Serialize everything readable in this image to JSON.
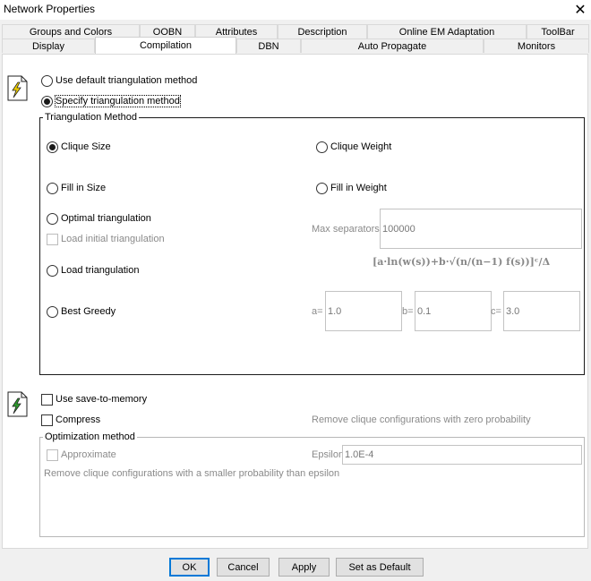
{
  "window": {
    "title": "Network Properties"
  },
  "tabs": {
    "row1": [
      "Groups and Colors",
      "OOBN",
      "Attributes",
      "Description",
      "Online EM Adaptation",
      "ToolBar"
    ],
    "row2": [
      "Display",
      "Compilation",
      "DBN",
      "Auto Propagate",
      "Monitors"
    ],
    "active": "Compilation"
  },
  "triangulation": {
    "use_default_label": "Use default triangulation method",
    "specify_label": "Specify triangulation method",
    "group_label": "Triangulation Method",
    "clique_size": "Clique Size",
    "clique_weight": "Clique Weight",
    "fill_in_size": "Fill in Size",
    "fill_in_weight": "Fill in Weight",
    "optimal": "Optimal triangulation",
    "load_initial": "Load initial triangulation",
    "load": "Load triangulation",
    "best_greedy": "Best Greedy",
    "max_separators_label": "Max separators",
    "max_separators_value": "100000",
    "formula": "[a·ln(w(s))+b·√(n/(n−1) f(s))]ᶜ/Δ",
    "a_label": "a=",
    "a_value": "1.0",
    "b_label": "b=",
    "b_value": "0.1",
    "c_label": "c=",
    "c_value": "3.0"
  },
  "memory": {
    "save_to_memory": "Use save-to-memory",
    "compress": "Compress",
    "remove_zero": "Remove clique configurations with zero probability",
    "optimization_label": "Optimization method",
    "approximate": "Approximate",
    "epsilon_label": "Epsilon",
    "epsilon_value": "1.0E-4",
    "remove_smaller": "Remove clique configurations with a smaller probability than epsilon"
  },
  "buttons": {
    "ok": "OK",
    "cancel": "Cancel",
    "apply": "Apply",
    "set_default": "Set as Default"
  },
  "icons": {
    "close": "close-icon",
    "compile_doc": "lightning-document-icon",
    "memory_doc": "green-lightning-document-icon"
  },
  "colors": {
    "focus_border": "#0078d7",
    "icon_yellow": "#f2d100",
    "icon_green": "#2e9e2e"
  }
}
